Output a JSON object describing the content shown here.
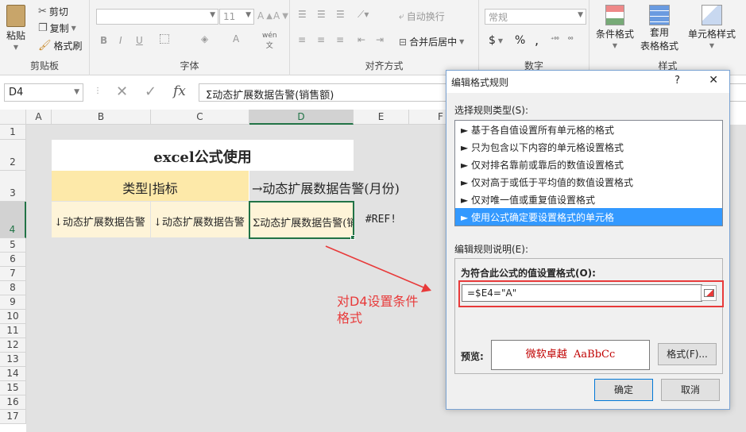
{
  "ribbon": {
    "clipboard": {
      "paste": "粘贴",
      "cut": "剪切",
      "copy": "复制",
      "format_painter": "格式刷",
      "label": "剪贴板"
    },
    "font": {
      "size": "11",
      "bold": "B",
      "italic": "I",
      "underline": "U",
      "label": "字体",
      "wen": "wén"
    },
    "alignment": {
      "wrap": "自动换行",
      "merge": "合并后居中",
      "label": "对齐方式"
    },
    "number": {
      "format": "常规",
      "currency": "$",
      "percent": "%",
      "comma": ",",
      "label": "数字"
    },
    "styles": {
      "conditional": "条件格式",
      "table_line1": "套用",
      "table_line2": "表格格式",
      "cell_styles": "单元格样式",
      "label": "样式"
    }
  },
  "formula_bar": {
    "name_box": "D4",
    "fx": "fx",
    "formula": "Σ动态扩展数据告警(销售额)"
  },
  "columns": [
    "A",
    "B",
    "C",
    "D",
    "E",
    "F"
  ],
  "rows": [
    "1",
    "2",
    "3",
    "4",
    "5",
    "6",
    "7",
    "8",
    "9",
    "10",
    "11",
    "12",
    "13",
    "14",
    "15",
    "16",
    "17"
  ],
  "cells": {
    "title": "excel公式使用",
    "b3": "类型|指标",
    "d3": "→动态扩展数据告警(月份)",
    "b4": "↓动态扩展数据告警",
    "c4": "↓动态扩展数据告警",
    "d4": "Σ动态扩展数据告警(销售额)",
    "e4": "#REF!"
  },
  "annotation": {
    "line1": "对D4设置条件",
    "line2": "格式",
    "color": "#e83a3a"
  },
  "dialog": {
    "title": "编辑格式规则",
    "help": "?",
    "close": "✕",
    "select_type_label": "选择规则类型(S):",
    "rule_types": [
      "► 基于各自值设置所有单元格的格式",
      "► 只为包含以下内容的单元格设置格式",
      "► 仅对排名靠前或靠后的数值设置格式",
      "► 仅对高于或低于平均值的数值设置格式",
      "► 仅对唯一值或重复值设置格式",
      "► 使用公式确定要设置格式的单元格"
    ],
    "edit_desc_label": "编辑规则说明(E):",
    "formula_label": "为符合此公式的值设置格式(O):",
    "formula_value": "=$E4=\"A\"",
    "preview_label": "预览:",
    "preview_text": "微软卓越  AaBbCc",
    "format_button": "格式(F)...",
    "ok": "确定",
    "cancel": "取消"
  },
  "colors": {
    "header_fill": "#fde9a9",
    "light_fill": "#fef4d8",
    "selected_border": "#217346",
    "highlight_red": "#e83a3a",
    "select_blue": "#3399ff"
  }
}
